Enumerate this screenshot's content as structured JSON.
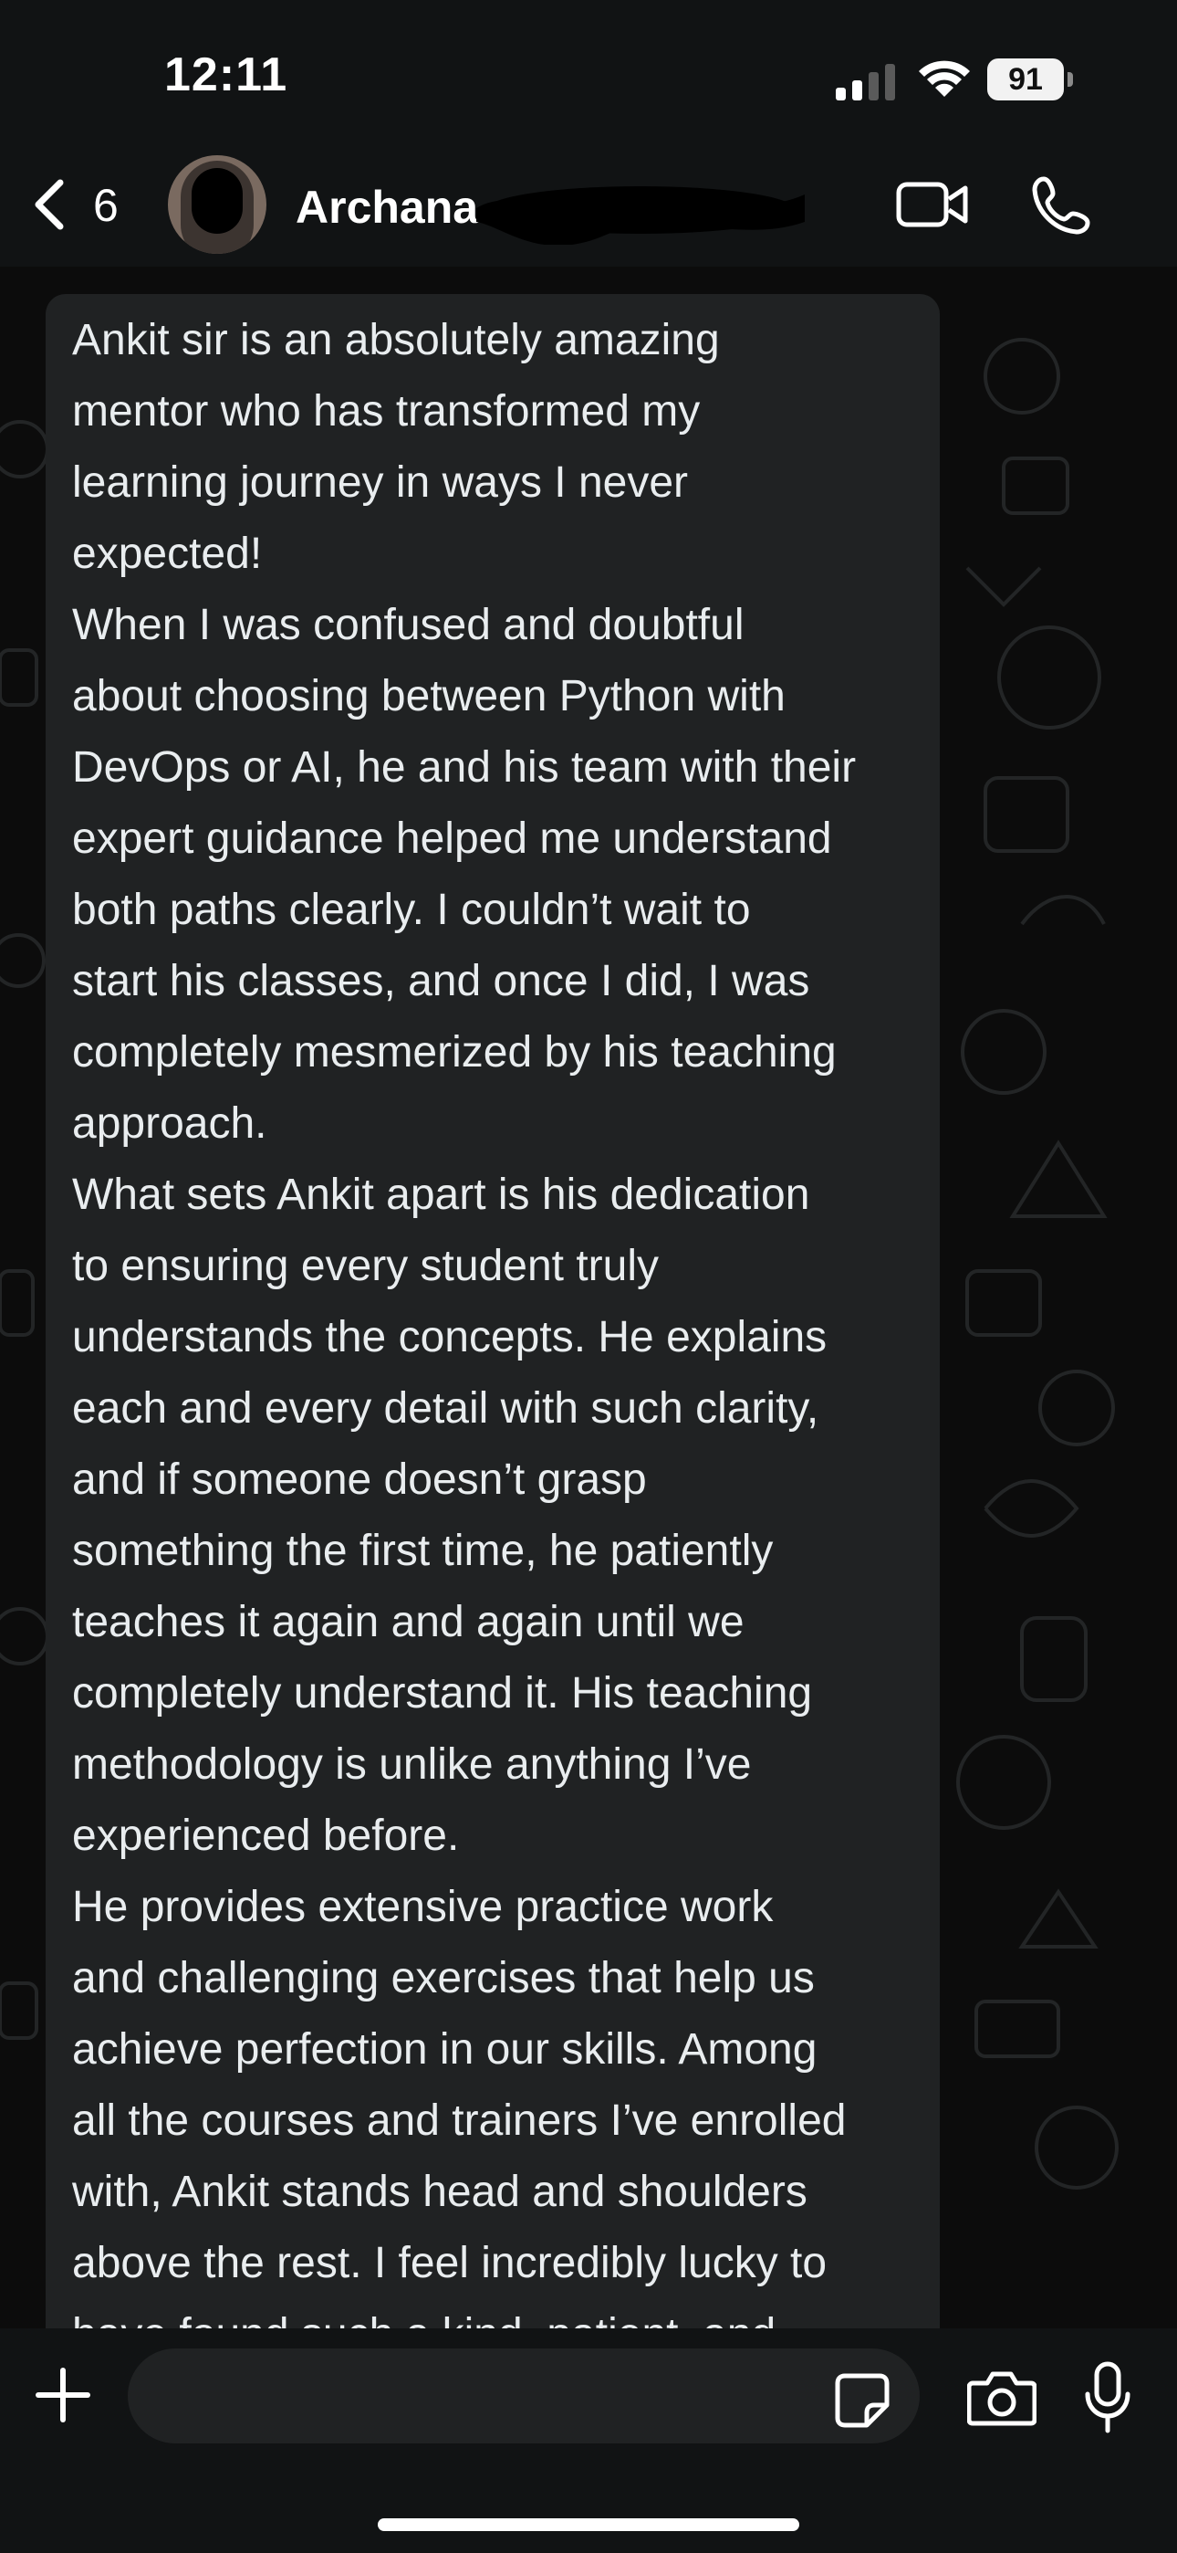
{
  "status_bar": {
    "time": "12:11",
    "battery_level": "91"
  },
  "header": {
    "back_count": "6",
    "contact_name": "Archana",
    "icons": [
      "chevron-left-icon",
      "video-camera-icon",
      "phone-icon"
    ]
  },
  "message": {
    "text": "Ankit sir is an absolutely amazing\nmentor who has transformed my\nlearning journey in ways I never\nexpected!\nWhen I was confused and doubtful\nabout choosing between Python with\nDevOps or AI, he and his team with their\nexpert guidance helped me understand\nboth paths clearly. I couldn’t wait to\nstart his classes, and once I did, I was\ncompletely mesmerized by his teaching\napproach.\nWhat sets Ankit apart is his dedication\nto ensuring every student truly\nunderstands the concepts. He explains\neach and every detail with such clarity,\nand if someone doesn’t grasp\nsomething the first time, he patiently\nteaches it again and again until we\ncompletely understand it. His teaching\nmethodology is unlike anything I’ve\nexperienced before.\nHe provides extensive practice work\nand challenging exercises that help us\nachieve perfection in our skills. Among\nall the courses and trainers I’ve enrolled\nwith, Ankit stands head and shoulders\nabove the rest. I feel incredibly lucky to\nhave found such a kind, patient, and"
  },
  "input_bar": {
    "placeholder": "",
    "icons": [
      "plus-icon",
      "sticker-icon",
      "camera-icon",
      "microphone-icon"
    ]
  },
  "colors": {
    "background": "#0b0b0b",
    "bar": "#111314",
    "bubble": "#202223",
    "text": "#e9edef"
  }
}
